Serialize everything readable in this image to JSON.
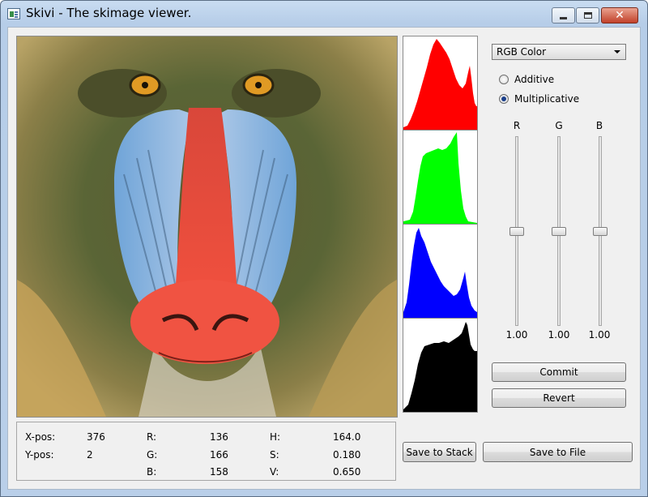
{
  "window": {
    "title": "Skivi - The skimage viewer.",
    "close_glyph": "✕"
  },
  "mode_select": {
    "value": "RGB Color"
  },
  "radios": [
    {
      "label": "Additive",
      "checked": false
    },
    {
      "label": "Multiplicative",
      "checked": true
    }
  ],
  "sliders": [
    {
      "label": "R",
      "value": "1.00",
      "level": 0.5
    },
    {
      "label": "G",
      "value": "1.00",
      "level": 0.5
    },
    {
      "label": "B",
      "value": "1.00",
      "level": 0.5
    }
  ],
  "buttons": {
    "commit": "Commit",
    "revert": "Revert",
    "save_stack": "Save to Stack",
    "save_file": "Save to File"
  },
  "histograms": [
    {
      "color": "#ff0000"
    },
    {
      "color": "#00ff00"
    },
    {
      "color": "#0000ff"
    },
    {
      "color": "#000000"
    }
  ],
  "info": {
    "xpos_label": "X-pos:",
    "xpos": "376",
    "ypos_label": "Y-pos:",
    "ypos": "2",
    "r_label": "R:",
    "r": "136",
    "g_label": "G:",
    "g": "166",
    "b_label": "B:",
    "b": "158",
    "h_label": "H:",
    "h": "164.0",
    "s_label": "S:",
    "s": "0.180",
    "v_label": "V:",
    "v": "0.650"
  }
}
